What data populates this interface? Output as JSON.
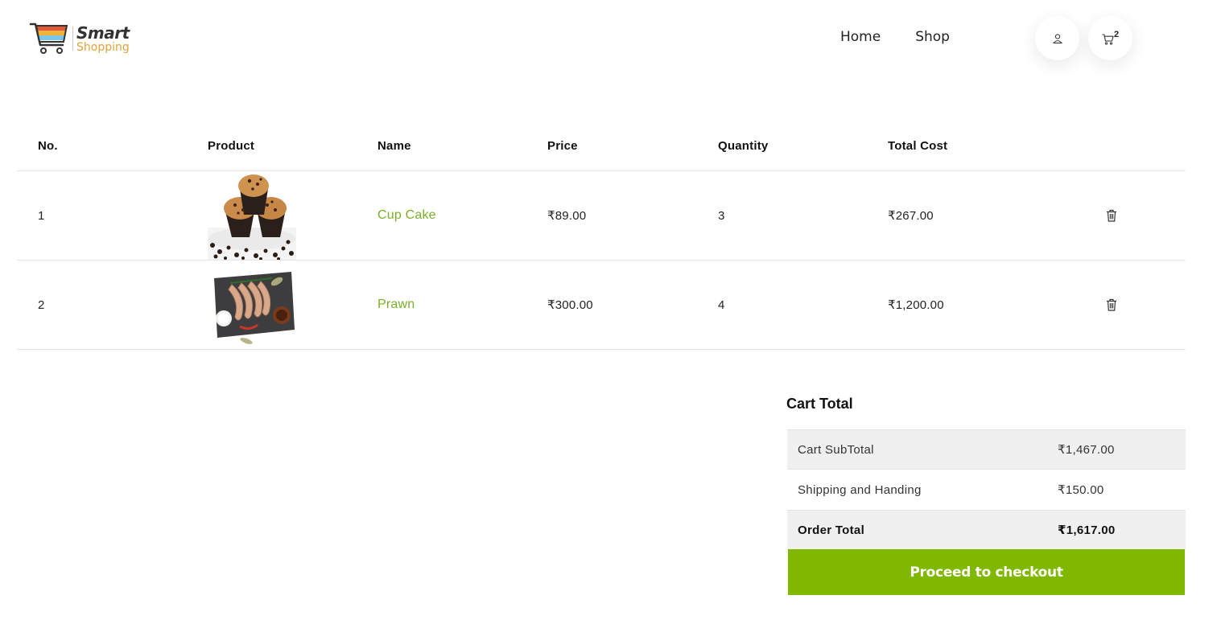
{
  "brand": {
    "name_top": "Smart",
    "name_bottom": "Shopping"
  },
  "nav": {
    "items": [
      {
        "label": "Home"
      },
      {
        "label": "Shop"
      }
    ]
  },
  "header_actions": {
    "user_icon": "user-icon",
    "cart_icon": "cart-icon",
    "cart_count": "2"
  },
  "table": {
    "columns": [
      "No.",
      "Product",
      "Name",
      "Price",
      "Quantity",
      "Total Cost"
    ],
    "rows": [
      {
        "no": "1",
        "product_image": "cupcake-image",
        "name": "Cup Cake",
        "price": "₹89.00",
        "quantity": "3",
        "total": "₹267.00",
        "delete_icon": "trash-icon"
      },
      {
        "no": "2",
        "product_image": "prawn-image",
        "name": "Prawn",
        "price": "₹300.00",
        "quantity": "4",
        "total": "₹1,200.00",
        "delete_icon": "trash-icon"
      }
    ]
  },
  "cart_total": {
    "title": "Cart Total",
    "lines": [
      {
        "label": "Cart SubTotal",
        "value": "₹1,467.00"
      },
      {
        "label": "Shipping and Handing",
        "value": "₹150.00"
      },
      {
        "label": "Order Total",
        "value": "₹1,617.00"
      }
    ],
    "checkout_label": "Proceed to checkout"
  },
  "colors": {
    "accent_green": "#80b800",
    "link_green": "#7ab028",
    "brand_orange": "#e2a33a"
  }
}
